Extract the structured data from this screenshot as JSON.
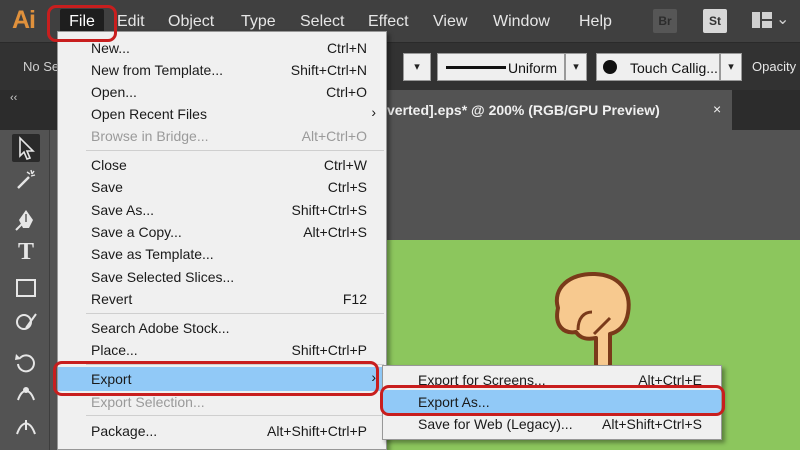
{
  "app": {
    "logo": "Ai",
    "accent_color": "#e0913c",
    "highlight_color": "#c81e1e",
    "menu_hover_color": "#91c9f7"
  },
  "menubar": {
    "items": [
      "File",
      "Edit",
      "Object",
      "Type",
      "Select",
      "Effect",
      "View",
      "Window",
      "Help"
    ],
    "bridge_badge": "Br",
    "stock_badge": "St",
    "workspace_icon": "workspace-grid-icon"
  },
  "controlbar": {
    "selection_text": "No Se",
    "stroke_profile": "Uniform",
    "brush": "Touch Callig...",
    "opacity_label": "Opacity"
  },
  "document": {
    "tab_title": "verted].eps* @ 200% (RGB/GPU Preview)",
    "close": "×",
    "collapse": "‹‹",
    "artboard_color": "#8cc65d"
  },
  "tools": [
    "selection-arrow-icon",
    "magic-wand-icon",
    "pen-icon",
    "type-icon",
    "rectangle-icon",
    "shaper-icon",
    "rotate-icon",
    "puppet-warp-icon",
    "width-tool-icon"
  ],
  "file_menu": {
    "items": [
      {
        "label": "New...",
        "shortcut": "Ctrl+N"
      },
      {
        "label": "New from Template...",
        "shortcut": "Shift+Ctrl+N"
      },
      {
        "label": "Open...",
        "shortcut": "Ctrl+O"
      },
      {
        "label": "Open Recent Files",
        "shortcut": "",
        "submenu": true
      },
      {
        "label": "Browse in Bridge...",
        "shortcut": "Alt+Ctrl+O",
        "disabled": true
      },
      {
        "label": "Close",
        "shortcut": "Ctrl+W"
      },
      {
        "label": "Save",
        "shortcut": "Ctrl+S"
      },
      {
        "label": "Save As...",
        "shortcut": "Shift+Ctrl+S"
      },
      {
        "label": "Save a Copy...",
        "shortcut": "Alt+Ctrl+S"
      },
      {
        "label": "Save as Template...",
        "shortcut": ""
      },
      {
        "label": "Save Selected Slices...",
        "shortcut": ""
      },
      {
        "label": "Revert",
        "shortcut": "F12"
      },
      {
        "label": "Search Adobe Stock...",
        "shortcut": ""
      },
      {
        "label": "Place...",
        "shortcut": "Shift+Ctrl+P"
      },
      {
        "label": "Export",
        "shortcut": "",
        "submenu": true,
        "highlighted": true
      },
      {
        "label": "Export Selection...",
        "shortcut": "",
        "disabled": true
      },
      {
        "label": "Package...",
        "shortcut": "Alt+Shift+Ctrl+P"
      }
    ]
  },
  "export_submenu": {
    "items": [
      {
        "label": "Export for Screens...",
        "shortcut": "Alt+Ctrl+E"
      },
      {
        "label": "Export As...",
        "shortcut": "",
        "highlighted": true
      },
      {
        "label": "Save for Web (Legacy)...",
        "shortcut": "Alt+Shift+Ctrl+S"
      }
    ]
  }
}
